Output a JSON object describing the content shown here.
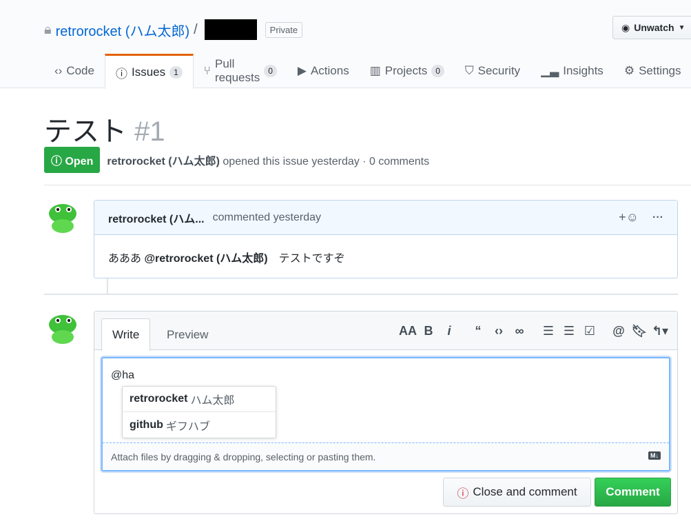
{
  "repo": {
    "owner": "retrorocket (ハム太郎)",
    "separator": "/",
    "visibility": "Private"
  },
  "watch": {
    "label": "Unwatch"
  },
  "tabs": [
    {
      "label": "Code"
    },
    {
      "label": "Issues",
      "count": "1"
    },
    {
      "label": "Pull requests",
      "count": "0"
    },
    {
      "label": "Actions"
    },
    {
      "label": "Projects",
      "count": "0"
    },
    {
      "label": "Security"
    },
    {
      "label": "Insights"
    },
    {
      "label": "Settings"
    }
  ],
  "issue": {
    "title": "テスト",
    "number": "#1",
    "state": "Open",
    "author": "retrorocket (ハム太郎)",
    "meta": "opened this issue yesterday · 0 comments"
  },
  "comment": {
    "author": "retrorocket (ハム...",
    "time": "commented yesterday",
    "reaction": "+☺",
    "more": "···",
    "body_prefix": "あああ ",
    "mention": "@retrorocket (ハム太郎)",
    "body_suffix": "　テストですぞ"
  },
  "editor": {
    "tab_write": "Write",
    "tab_preview": "Preview",
    "value": "@ha",
    "attach": "Attach files by dragging & dropping, selecting or pasting them.",
    "md_badge": "M↓",
    "suggestions": [
      {
        "login": "retrorocket",
        "name": "ハム太郎"
      },
      {
        "login": "github",
        "name": "ギフハブ"
      }
    ],
    "close_label": "Close and comment",
    "comment_label": "Comment"
  },
  "colors": {
    "accent": "#0366d6",
    "open": "#28a745",
    "tab_active": "#e36209"
  }
}
